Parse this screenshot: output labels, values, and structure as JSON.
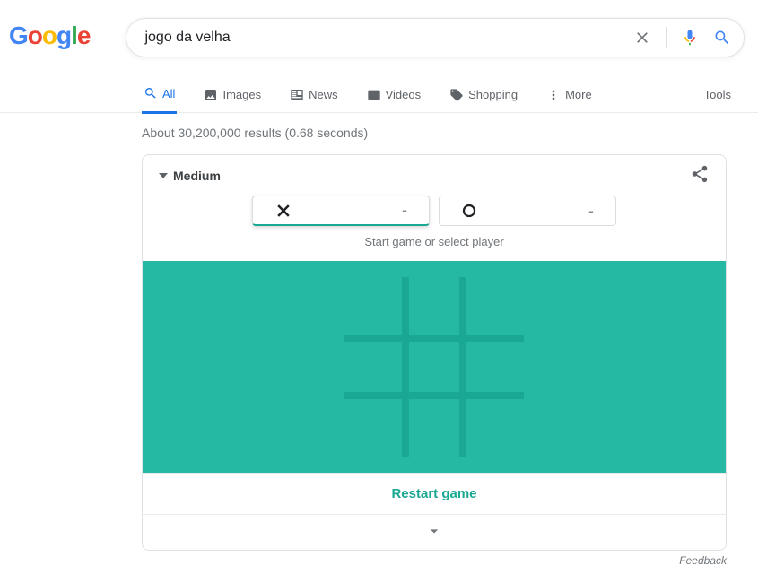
{
  "logo": {
    "g1": "G",
    "o1": "o",
    "o2": "o",
    "g2": "g",
    "l": "l",
    "e": "e"
  },
  "logo_colors": {
    "g1": "#4285F4",
    "o1": "#EA4335",
    "o2": "#FBBC05",
    "g2": "#4285F4",
    "l": "#34A853",
    "e": "#EA4335"
  },
  "search": {
    "query": "jogo da velha"
  },
  "tabs": {
    "all": "All",
    "images": "Images",
    "news": "News",
    "videos": "Videos",
    "shopping": "Shopping",
    "more": "More",
    "tools": "Tools"
  },
  "result_stats": "About 30,200,000 results (0.68 seconds)",
  "game": {
    "difficulty": "Medium",
    "x_score": "-",
    "o_score": "-",
    "hint": "Start game or select player",
    "restart": "Restart game"
  },
  "feedback": "Feedback"
}
